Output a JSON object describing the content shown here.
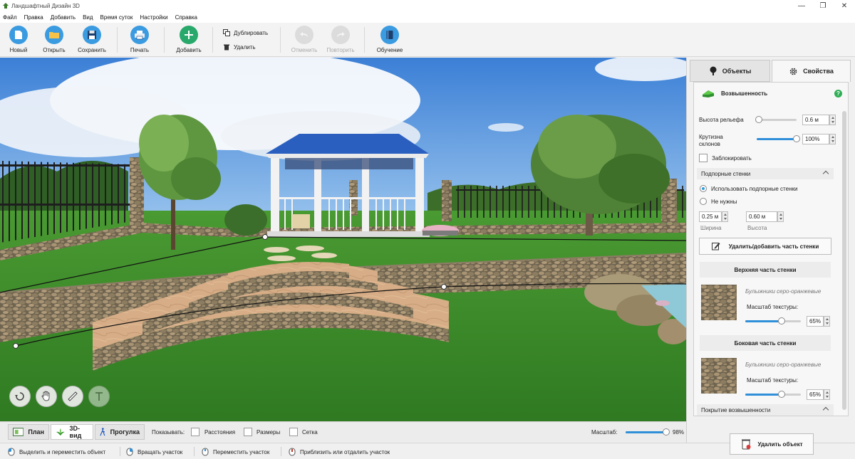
{
  "window": {
    "title": "Ландшафтный Дизайн 3D",
    "minimize": "—",
    "maximize": "❐",
    "close": "✕"
  },
  "menu": [
    "Файл",
    "Правка",
    "Добавить",
    "Вид",
    "Время суток",
    "Настройки",
    "Справка"
  ],
  "toolbar": {
    "new": "Новый",
    "open": "Открыть",
    "save": "Сохранить",
    "print": "Печать",
    "add": "Добавить",
    "duplicate": "Дублировать",
    "delete": "Удалить",
    "undo": "Отменить",
    "redo": "Повторить",
    "learn": "Обучение"
  },
  "view_modes": {
    "plan": "План",
    "view3d": "3D-вид",
    "walk": "Прогулка"
  },
  "show": {
    "label": "Показывать:",
    "distances": "Расстояния",
    "sizes": "Размеры",
    "grid": "Сетка"
  },
  "scale": {
    "label": "Масштаб:",
    "value": "98%",
    "fraction": 0.98
  },
  "status": {
    "select_move": "Выделить и переместить объект",
    "rotate": "Вращать участок",
    "move": "Переместить участок",
    "zoom": "Приблизить или отдалить участок"
  },
  "panel": {
    "tabs": {
      "objects": "Объекты",
      "properties": "Свойства"
    },
    "object_name": "Возвышенность",
    "help": "?",
    "relief_height": {
      "label": "Высота рельефа",
      "value": "0.6 м",
      "fraction": 0.05
    },
    "slope": {
      "label1": "Крутизна",
      "label2": "склонов",
      "value": "100%",
      "fraction": 1.0
    },
    "lock": "Заблокировать",
    "retaining": {
      "title": "Подпорные стенки",
      "use": "Использовать подпорные стенки",
      "none": "Не нужны",
      "width_value": "0.25 м",
      "width_label": "Ширина",
      "height_value": "0.60 м",
      "height_label": "Высота",
      "edit_button": "Удалить/добавить часть стенки"
    },
    "top_part": {
      "title": "Верхняя часть стенки",
      "texture": "Булыжники серо-оранжевые",
      "scale_label": "Масштаб текстуры:",
      "scale_value": "65%",
      "fraction": 0.65
    },
    "side_part": {
      "title": "Боковая часть стенки",
      "texture": "Булыжники серо-оранжевые",
      "scale_label": "Масштаб текстуры:",
      "scale_value": "65%",
      "fraction": 0.65
    },
    "cover_title": "Покрытие возвышенности",
    "delete_button": "Удалить объект"
  },
  "colors": {
    "accent": "#2f8fd8",
    "grass": "#3f8a2a",
    "roof": "#2a5fc0",
    "add": "#28a86b"
  }
}
